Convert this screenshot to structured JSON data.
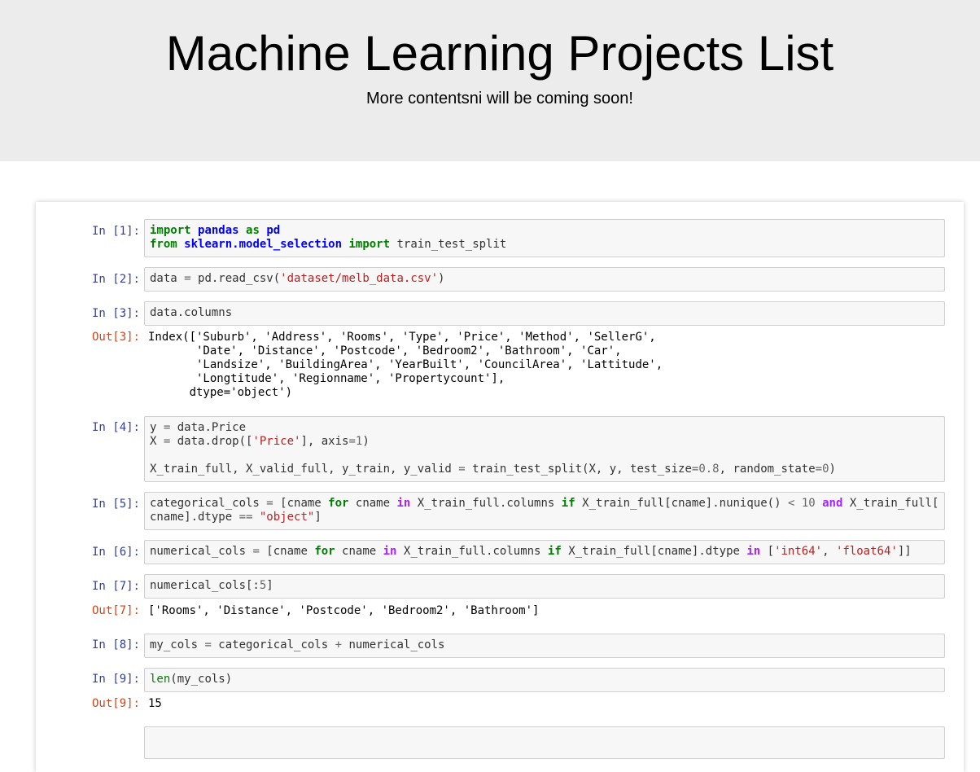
{
  "header": {
    "title": "Machine Learning Projects List",
    "subtitle": "More contentsni will be coming soon!"
  },
  "cells": [
    {
      "prompt": "In [1]:",
      "code_lines": [
        [
          [
            "kw",
            "import"
          ],
          [
            "t",
            " "
          ],
          [
            "mod",
            "pandas"
          ],
          [
            "t",
            " "
          ],
          [
            "kw",
            "as"
          ],
          [
            "t",
            " "
          ],
          [
            "mod",
            "pd"
          ]
        ],
        [
          [
            "kw",
            "from"
          ],
          [
            "t",
            " "
          ],
          [
            "mod",
            "sklearn.model_selection"
          ],
          [
            "t",
            " "
          ],
          [
            "kw",
            "import"
          ],
          [
            "t",
            " train_test_split"
          ]
        ]
      ]
    },
    {
      "prompt": "In [2]:",
      "code_lines": [
        [
          [
            "t",
            "data "
          ],
          [
            "op",
            "="
          ],
          [
            "t",
            " pd.read_csv("
          ],
          [
            "str",
            "'dataset/melb_data.csv'"
          ],
          [
            "t",
            ")"
          ]
        ]
      ]
    },
    {
      "prompt": "In [3]:",
      "code_lines": [
        [
          [
            "t",
            "data.columns"
          ]
        ]
      ],
      "out_prompt": "Out[3]:",
      "output": "Index(['Suburb', 'Address', 'Rooms', 'Type', 'Price', 'Method', 'SellerG',\n       'Date', 'Distance', 'Postcode', 'Bedroom2', 'Bathroom', 'Car',\n       'Landsize', 'BuildingArea', 'YearBuilt', 'CouncilArea', 'Lattitude',\n       'Longtitude', 'Regionname', 'Propertycount'],\n      dtype='object')"
    },
    {
      "prompt": "In [4]:",
      "code_lines": [
        [
          [
            "t",
            "y "
          ],
          [
            "op",
            "="
          ],
          [
            "t",
            " data.Price"
          ]
        ],
        [
          [
            "t",
            "X "
          ],
          [
            "op",
            "="
          ],
          [
            "t",
            " data.drop(["
          ],
          [
            "str",
            "'Price'"
          ],
          [
            "t",
            "], axis"
          ],
          [
            "op",
            "="
          ],
          [
            "num",
            "1"
          ],
          [
            "t",
            ")"
          ]
        ],
        [],
        [
          [
            "t",
            "X_train_full, X_valid_full, y_train, y_valid "
          ],
          [
            "op",
            "="
          ],
          [
            "t",
            " train_test_split(X, y, test_size"
          ],
          [
            "op",
            "="
          ],
          [
            "num",
            "0.8"
          ],
          [
            "t",
            ", random_state"
          ],
          [
            "op",
            "="
          ],
          [
            "num",
            "0"
          ],
          [
            "t",
            ")"
          ]
        ]
      ]
    },
    {
      "prompt": "In [5]:",
      "code_lines": [
        [
          [
            "t",
            "categorical_cols "
          ],
          [
            "op",
            "="
          ],
          [
            "t",
            " [cname "
          ],
          [
            "kw",
            "for"
          ],
          [
            "t",
            " cname "
          ],
          [
            "op-w",
            "in"
          ],
          [
            "t",
            " X_train_full.columns "
          ],
          [
            "kw",
            "if"
          ],
          [
            "t",
            " X_train_full[cname].nunique() "
          ],
          [
            "op",
            "<"
          ],
          [
            "t",
            " "
          ],
          [
            "num",
            "10"
          ],
          [
            "t",
            " "
          ],
          [
            "op-w",
            "and"
          ],
          [
            "t",
            " X_train_full["
          ]
        ],
        [
          [
            "t",
            "cname].dtype "
          ],
          [
            "op",
            "=="
          ],
          [
            "t",
            " "
          ],
          [
            "str",
            "\"object\""
          ],
          [
            "t",
            "]"
          ]
        ]
      ]
    },
    {
      "prompt": "In [6]:",
      "code_lines": [
        [
          [
            "t",
            "numerical_cols "
          ],
          [
            "op",
            "="
          ],
          [
            "t",
            " [cname "
          ],
          [
            "kw",
            "for"
          ],
          [
            "t",
            " cname "
          ],
          [
            "op-w",
            "in"
          ],
          [
            "t",
            " X_train_full.columns "
          ],
          [
            "kw",
            "if"
          ],
          [
            "t",
            " X_train_full[cname].dtype "
          ],
          [
            "op-w",
            "in"
          ],
          [
            "t",
            " ["
          ],
          [
            "str",
            "'int64'"
          ],
          [
            "t",
            ", "
          ],
          [
            "str",
            "'float64'"
          ],
          [
            "t",
            "]]"
          ]
        ]
      ]
    },
    {
      "prompt": "In [7]:",
      "code_lines": [
        [
          [
            "t",
            "numerical_cols[:"
          ],
          [
            "num",
            "5"
          ],
          [
            "t",
            "]"
          ]
        ]
      ],
      "out_prompt": "Out[7]:",
      "output": "['Rooms', 'Distance', 'Postcode', 'Bedroom2', 'Bathroom']"
    },
    {
      "prompt": "In [8]:",
      "code_lines": [
        [
          [
            "t",
            "my_cols "
          ],
          [
            "op",
            "="
          ],
          [
            "t",
            " categorical_cols "
          ],
          [
            "op",
            "+"
          ],
          [
            "t",
            " numerical_cols"
          ]
        ]
      ]
    },
    {
      "prompt": "In [9]:",
      "code_lines": [
        [
          [
            "bi",
            "len"
          ],
          [
            "t",
            "(my_cols)"
          ]
        ]
      ],
      "out_prompt": "Out[9]:",
      "output": "15"
    }
  ]
}
